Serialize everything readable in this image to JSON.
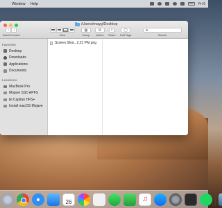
{
  "menubar": {
    "apple_glyph": "",
    "items": [
      "Window",
      "Help"
    ],
    "clock": "Fri 0"
  },
  "window": {
    "path": "/Users/mayg/Desktop",
    "toolbar": {
      "nav_label": "Back/Forward",
      "view_label": "View",
      "group_label": "Group",
      "action_label": "Action",
      "share_label": "Share",
      "tags_label": "Edit Tags",
      "search_label": "Search",
      "search_value": ""
    },
    "sidebar": {
      "favorites_header": "Favorites",
      "favorites": [
        {
          "label": "Desktop",
          "icon": "desktop-icon"
        },
        {
          "label": "Downloads",
          "icon": "downloads-icon"
        },
        {
          "label": "Applications",
          "icon": "applications-icon"
        },
        {
          "label": "Documents",
          "icon": "documents-icon"
        }
      ],
      "locations_header": "Locations",
      "locations": [
        {
          "label": "MacBook Pro",
          "icon": "laptop-icon"
        },
        {
          "label": "Mojave SSD APFS",
          "icon": "disk-icon"
        },
        {
          "label": "El Capitan HFS+",
          "icon": "disk-icon"
        },
        {
          "label": "Install macOS Mojave",
          "icon": "disk-icon"
        }
      ]
    },
    "files": [
      {
        "name": "Screen Shot...2.21 PM.png"
      }
    ]
  },
  "dock": {
    "calendar_day": "26",
    "apps": [
      "Launchpad",
      "Chrome",
      "Safari",
      "Mail",
      "Photos",
      "Calendar",
      "Photos",
      "Messages",
      "FaceTime",
      "Music",
      "App Store",
      "System Preferences",
      "Terminal",
      "Spotify",
      "Other"
    ]
  }
}
